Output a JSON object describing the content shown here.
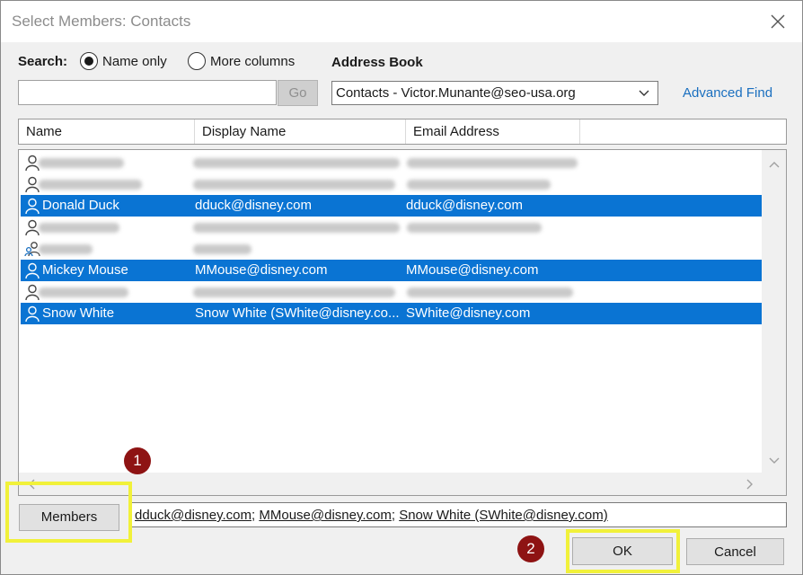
{
  "window": {
    "title": "Select Members: Contacts"
  },
  "search": {
    "label": "Search:",
    "option_name_only": "Name only",
    "option_more_columns": "More columns",
    "selected_option": "Name only",
    "input_value": "",
    "go_label": "Go"
  },
  "address_book": {
    "label": "Address Book",
    "selected": "Contacts - Victor.Munante@seo-usa.org",
    "advanced_find": "Advanced Find"
  },
  "columns": [
    "Name",
    "Display Name",
    "Email Address"
  ],
  "rows": [
    {
      "name": "",
      "display": "",
      "email": "",
      "blurred": true,
      "selected": false,
      "icon": "person-icon"
    },
    {
      "name": "",
      "display": "",
      "email": "",
      "blurred": true,
      "selected": false,
      "icon": "person-icon"
    },
    {
      "name": "Donald Duck",
      "display": "dduck@disney.com",
      "email": "dduck@disney.com",
      "blurred": false,
      "selected": true,
      "icon": "person-icon"
    },
    {
      "name": "",
      "display": "",
      "email": "",
      "blurred": true,
      "selected": false,
      "icon": "person-icon"
    },
    {
      "name": "",
      "display": "",
      "email": "",
      "blurred": true,
      "selected": false,
      "icon": "group-icon"
    },
    {
      "name": "Mickey Mouse",
      "display": "MMouse@disney.com",
      "email": "MMouse@disney.com",
      "blurred": false,
      "selected": true,
      "icon": "person-icon"
    },
    {
      "name": "",
      "display": "",
      "email": "",
      "blurred": true,
      "selected": false,
      "icon": "person-icon"
    },
    {
      "name": "Snow White",
      "display": "Snow White (SWhite@disney.co...",
      "email": "SWhite@disney.com",
      "blurred": false,
      "selected": true,
      "icon": "person-icon"
    }
  ],
  "members": {
    "button_label": "Members",
    "recipients": [
      "dduck@disney.com",
      "MMouse@disney.com",
      "Snow White (SWhite@disney.com)"
    ],
    "separator": "; "
  },
  "buttons": {
    "ok": "OK",
    "cancel": "Cancel"
  },
  "annotations": {
    "step1": "1",
    "step2": "2",
    "highlight_color": "#f1f13a",
    "badge_color": "#8e1313"
  },
  "colors": {
    "selection": "#0a74d3",
    "link": "#1a6fbf"
  }
}
